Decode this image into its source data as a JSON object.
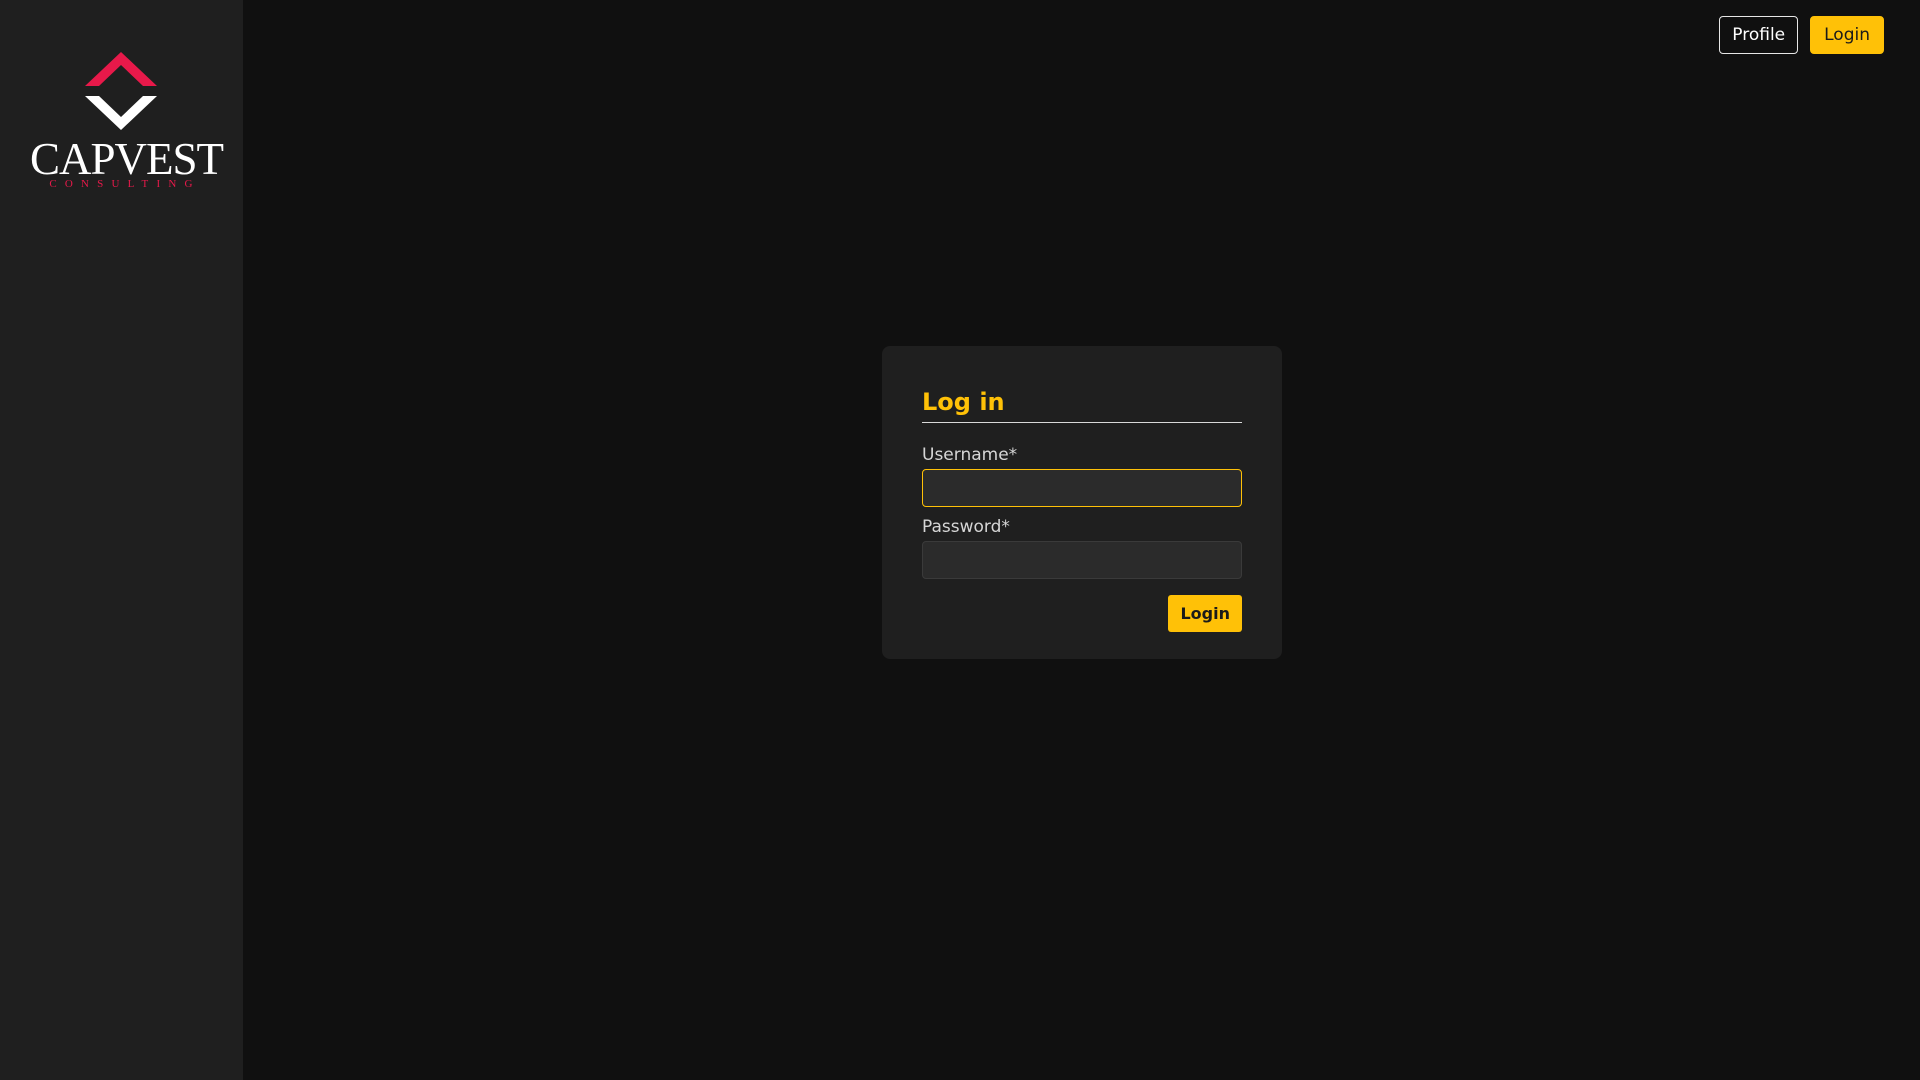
{
  "brand": {
    "name": "CAPVEST",
    "tagline": "CONSULTING",
    "primary_color": "#e8194a",
    "logo_icon": "chevron-diamond-logo-icon"
  },
  "topbar": {
    "profile_label": "Profile",
    "login_label": "Login",
    "accent_color": "#ffc107"
  },
  "login_form": {
    "title": "Log in",
    "username_label": "Username*",
    "username_value": "",
    "password_label": "Password*",
    "password_value": "",
    "submit_label": "Login"
  }
}
